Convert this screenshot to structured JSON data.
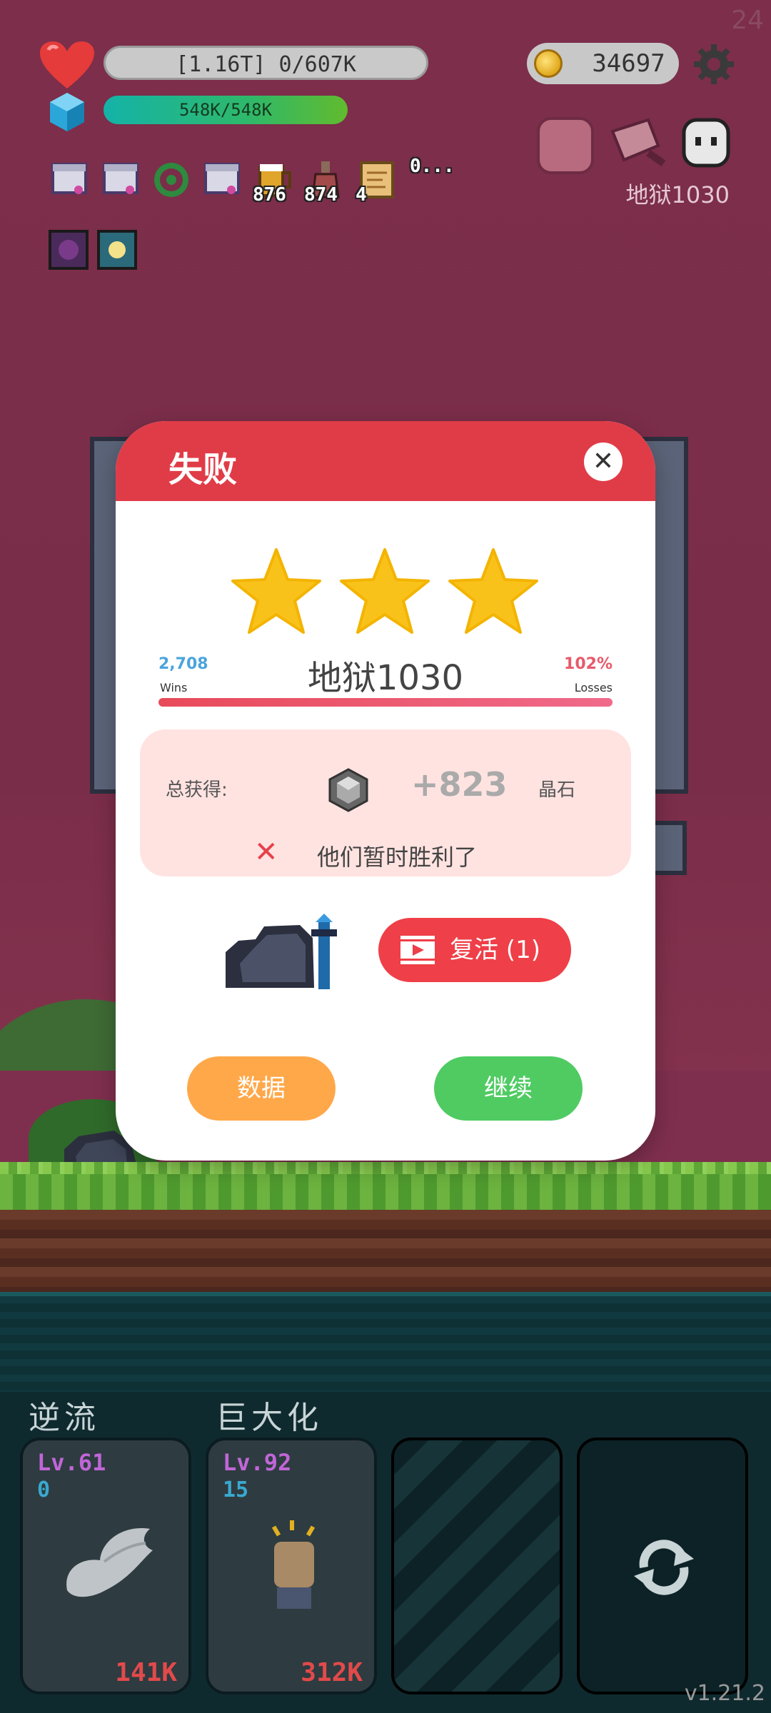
{
  "hud": {
    "hp_text": "[1.16T] 0/607K",
    "mp_text": "548K/548K",
    "coins": "34697",
    "stage": "地狱1030",
    "corner_number": "24",
    "items": [
      {
        "icon": "scroll-bow-icon",
        "count": ""
      },
      {
        "icon": "scroll-bow-icon",
        "count": ""
      },
      {
        "icon": "biohazard-icon",
        "count": ""
      },
      {
        "icon": "scroll-bow-icon",
        "count": ""
      },
      {
        "icon": "beer-mug-icon",
        "count": "876"
      },
      {
        "icon": "potion-bottle-icon",
        "count": "874"
      },
      {
        "icon": "treasure-map-icon",
        "count": "4"
      }
    ],
    "items_more": "0..."
  },
  "modal": {
    "title": "失败",
    "close": "✕",
    "stars": 3,
    "wins_value": "2,708",
    "wins_label": "Wins",
    "losses_value": "102%",
    "losses_label": "Losses",
    "level_name": "地狱1030",
    "reward_label": "总获得:",
    "reward_amount": "+823",
    "reward_unit": "晶石",
    "fail_text": "他们暂时胜利了",
    "revive_label": "复活 (1)",
    "data_button": "数据",
    "continue_button": "继续",
    "colors": {
      "header": "#e03c47",
      "data": "#ffa84a",
      "continue": "#4fcb62",
      "revive": "#ef3f48"
    }
  },
  "skills": {
    "names": [
      "逆流",
      "巨大化"
    ],
    "cards": [
      {
        "level": "Lv.61",
        "sub": "0",
        "cost": "141K",
        "icon": "wing-icon"
      },
      {
        "level": "Lv.92",
        "sub": "15",
        "cost": "312K",
        "icon": "fist-icon"
      }
    ]
  },
  "version": "v1.21.2"
}
